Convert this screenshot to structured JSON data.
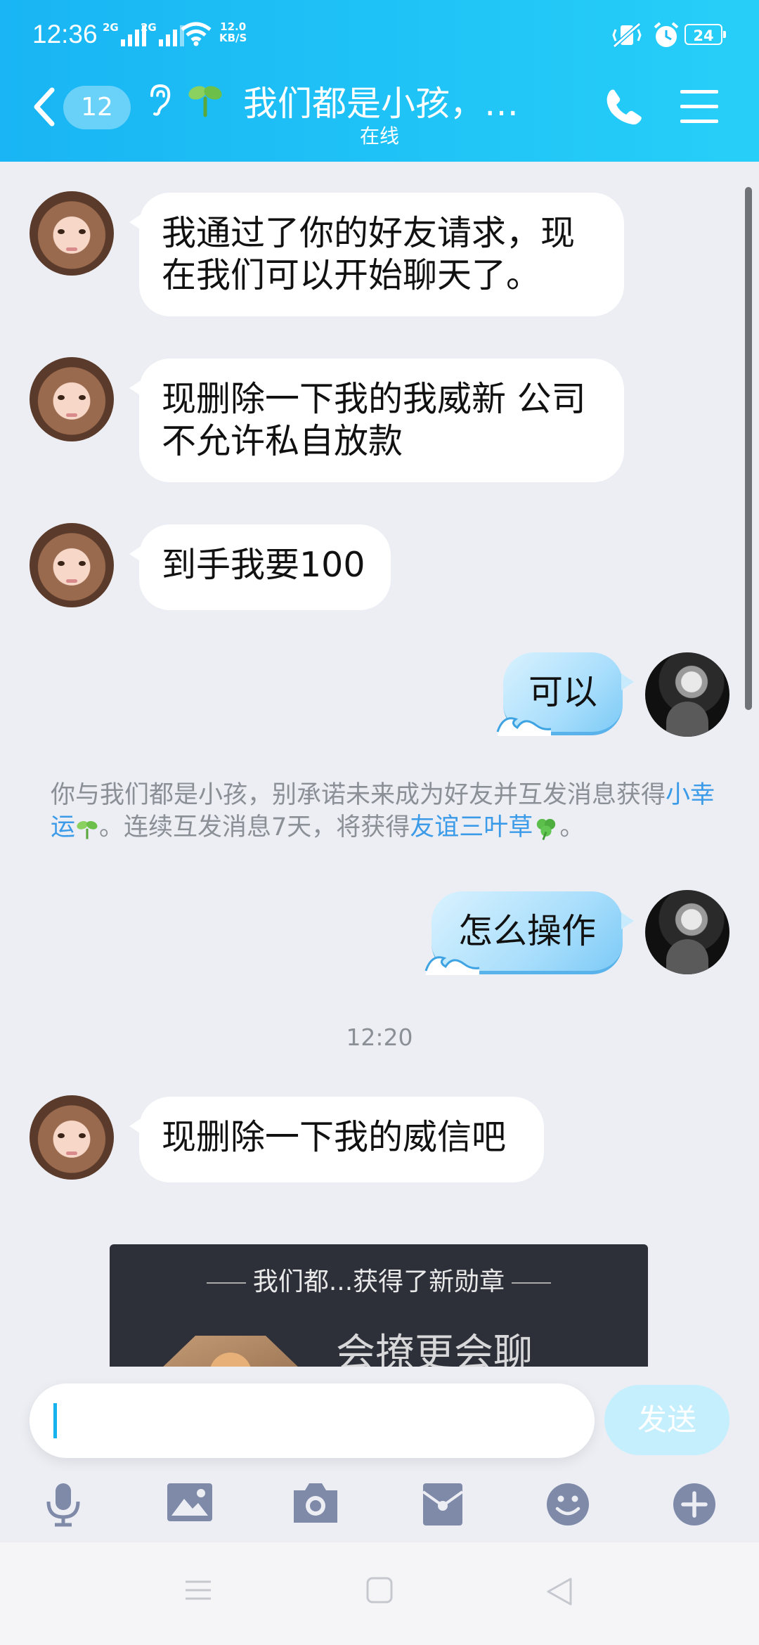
{
  "status_bar": {
    "time": "12:36",
    "network1": "2G",
    "network2": "2G",
    "speed_value": "12.0",
    "speed_unit": "KB/S",
    "battery": "24"
  },
  "header": {
    "unread_count": "12",
    "title": "我们都是小孩，…",
    "subtitle": "在线"
  },
  "messages": [
    {
      "side": "left",
      "text": "我通过了你的好友请求，现在我们可以开始聊天了。"
    },
    {
      "side": "left",
      "text": "现删除一下我的我威新 公司不允许私自放款"
    },
    {
      "side": "left",
      "text": "到手我要100"
    },
    {
      "side": "right",
      "text": "可以"
    },
    {
      "side": "right",
      "text": "怎么操作"
    },
    {
      "side": "left",
      "text": "现删除一下我的威信吧"
    }
  ],
  "system_notice": {
    "part1": "你与我们都是小孩，别承诺未来成为好友并互发消息获得",
    "link1": "小幸运",
    "part2": "。连续互发消息7天，将获得",
    "link2": "友谊三叶草",
    "part3": "。"
  },
  "timestamp": "12:20",
  "medal_card": {
    "header": "我们都...获得了新勋章",
    "title": "会撩更会聊"
  },
  "input": {
    "value": "",
    "send_label": "发送"
  },
  "toolbar": [
    "mic-icon",
    "image-icon",
    "camera-icon",
    "red-packet-icon",
    "emoji-icon",
    "plus-icon"
  ],
  "colors": {
    "header_start": "#19b5f4",
    "header_end": "#27cff8",
    "link": "#3b9be8",
    "send_disabled": "#c6effd"
  }
}
